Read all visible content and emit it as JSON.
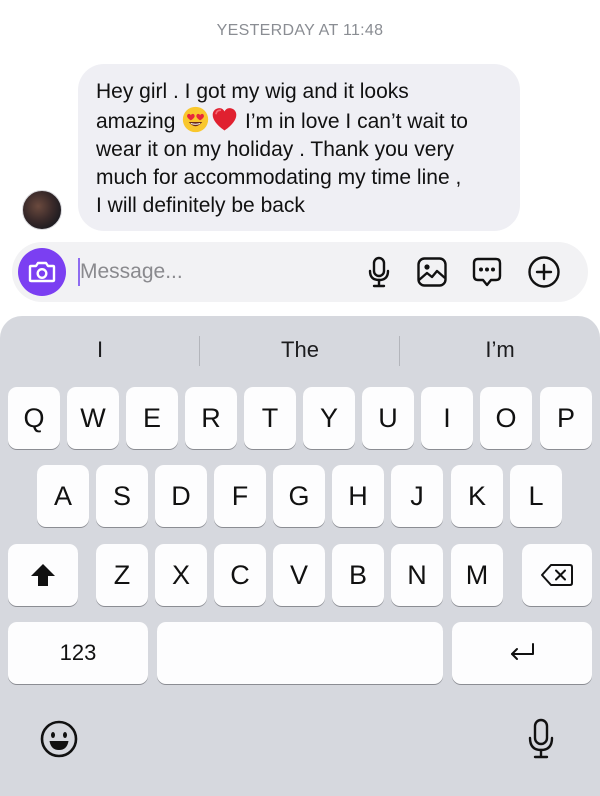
{
  "timestamp": "YESTERDAY AT 11:48",
  "message": {
    "lines": [
      {
        "before": "Hey girl . I got my wig and it looks",
        "after": ""
      },
      {
        "before": "amazing ",
        "emoji": [
          "heart-eyes-emoji",
          "red-heart-emoji"
        ],
        "after": " I’m in love I can’t wait to"
      },
      {
        "before": "wear it on my holiday . Thank you very",
        "after": ""
      },
      {
        "before": "much for accommodating my time line ,",
        "after": ""
      },
      {
        "before": "I will definitely be back",
        "after": ""
      }
    ]
  },
  "composer": {
    "placeholder": "Message...",
    "accent": "#7b3ff2",
    "icons": [
      "camera-icon",
      "microphone-icon",
      "image-icon",
      "sticker-icon",
      "add-icon"
    ]
  },
  "keyboard": {
    "suggestions": [
      "I",
      "The",
      "I’m"
    ],
    "row1": [
      "Q",
      "W",
      "E",
      "R",
      "T",
      "Y",
      "U",
      "I",
      "O",
      "P"
    ],
    "row2": [
      "A",
      "S",
      "D",
      "F",
      "G",
      "H",
      "J",
      "K",
      "L"
    ],
    "row3": [
      "Z",
      "X",
      "C",
      "V",
      "B",
      "N",
      "M"
    ],
    "numbers_label": "123",
    "icons": [
      "shift-icon",
      "delete-icon",
      "return-icon",
      "emoji-icon",
      "dictation-icon"
    ]
  }
}
